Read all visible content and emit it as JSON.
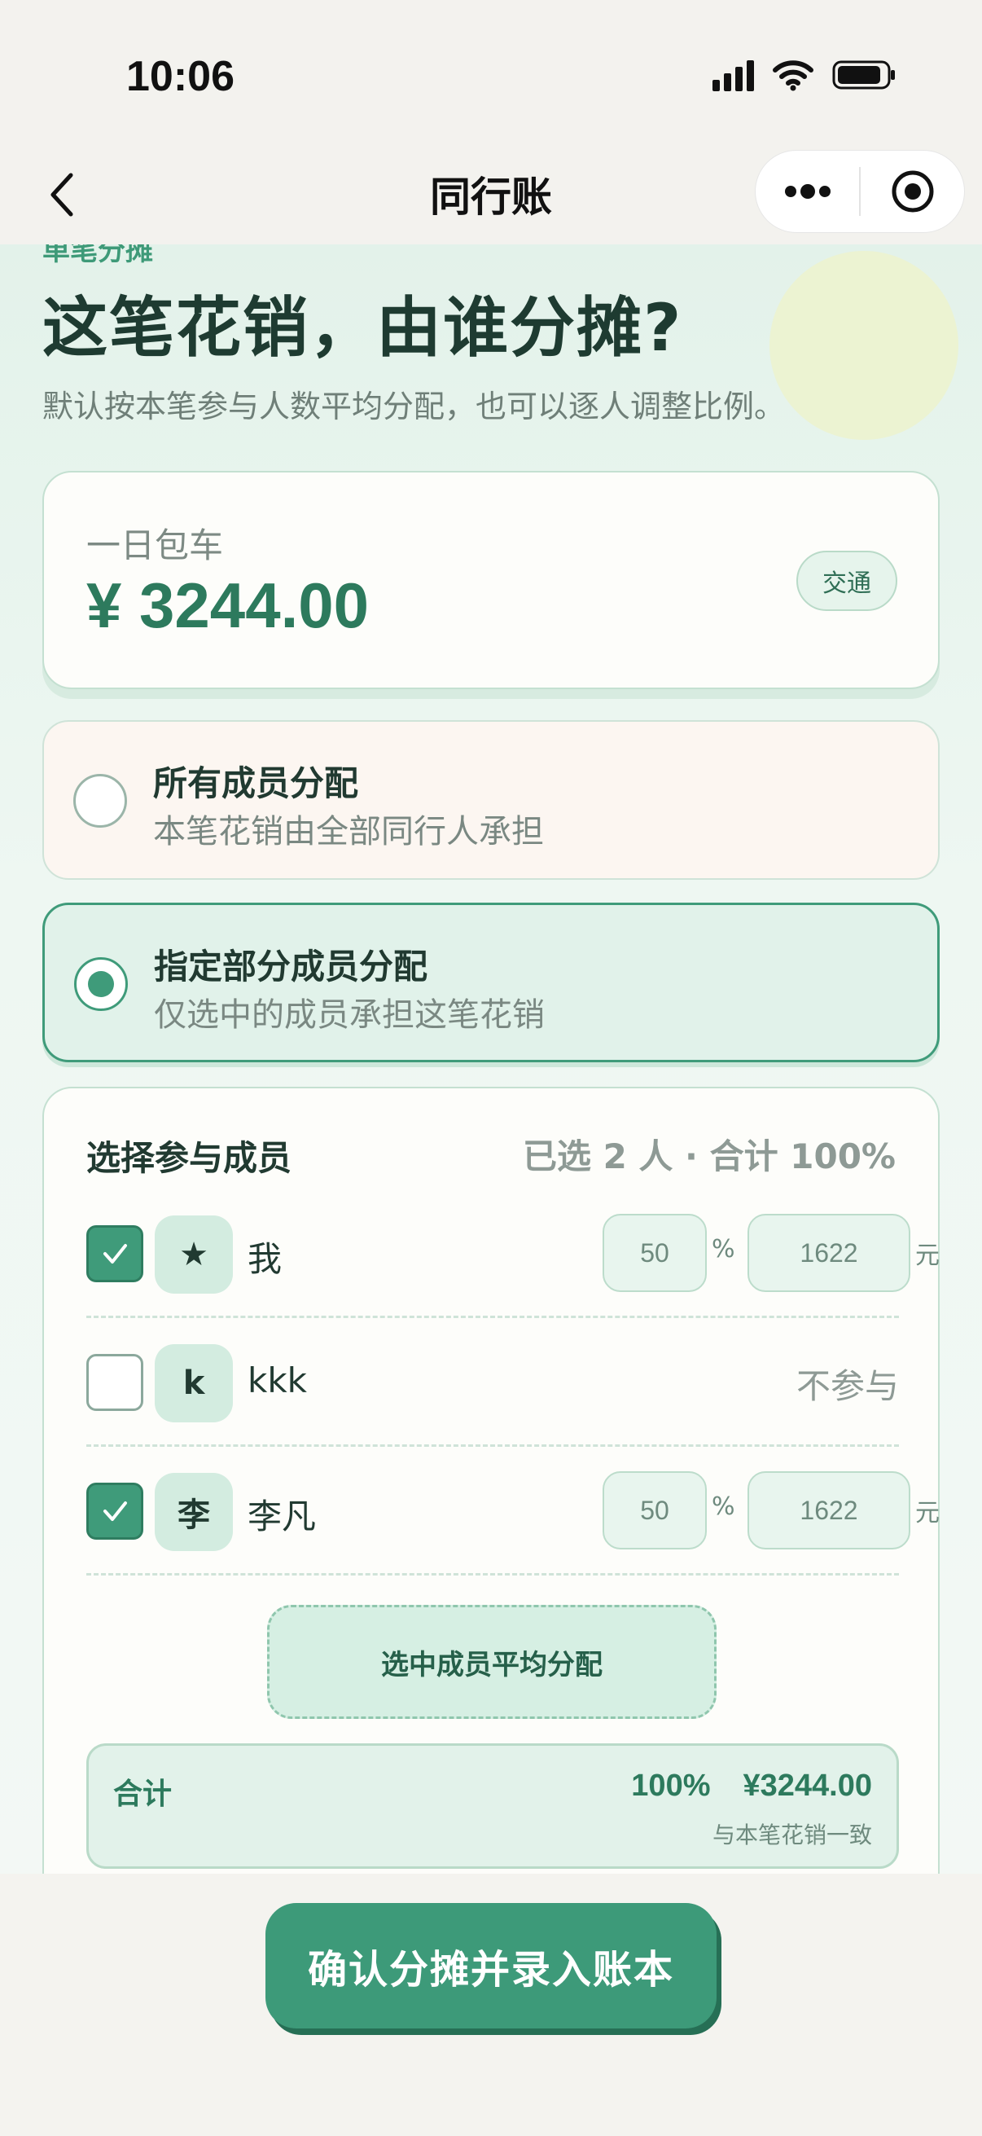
{
  "status_bar": {
    "time": "10:06"
  },
  "nav": {
    "title": "同行账"
  },
  "header": {
    "eyebrow": "单笔分摊",
    "title": "这笔花销，由谁分摊?",
    "subtitle": "默认按本笔参与人数平均分配，也可以逐人调整比例。"
  },
  "expense": {
    "name": "一日包车",
    "amount": "¥ 3244.00",
    "category": "交通"
  },
  "options": [
    {
      "title": "所有成员分配",
      "desc": "本笔花销由全部同行人承担",
      "selected": false
    },
    {
      "title": "指定部分成员分配",
      "desc": "仅选中的成员承担这笔花销",
      "selected": true
    }
  ],
  "members_panel": {
    "heading": "选择参与成员",
    "summary": "已选 2 人 · 合计 100%",
    "pct_unit": "%",
    "yuan_unit": "元",
    "not_join_label": "不参与",
    "members": [
      {
        "avatar": "★",
        "name": "我",
        "checked": true,
        "percent": "50",
        "amount": "1622"
      },
      {
        "avatar": "k",
        "name": "kkk",
        "checked": false
      },
      {
        "avatar": "李",
        "name": "李凡",
        "checked": true,
        "percent": "50",
        "amount": "1622"
      }
    ],
    "average_button": "选中成员平均分配",
    "total": {
      "label": "合计",
      "percent": "100%",
      "amount": "¥3244.00",
      "note": "与本笔花销一致"
    }
  },
  "confirm_button": "确认分摊并录入账本",
  "colors": {
    "accent": "#3d9a79",
    "accent_dark": "#2d7a5d",
    "background": "#f4f3ef"
  }
}
